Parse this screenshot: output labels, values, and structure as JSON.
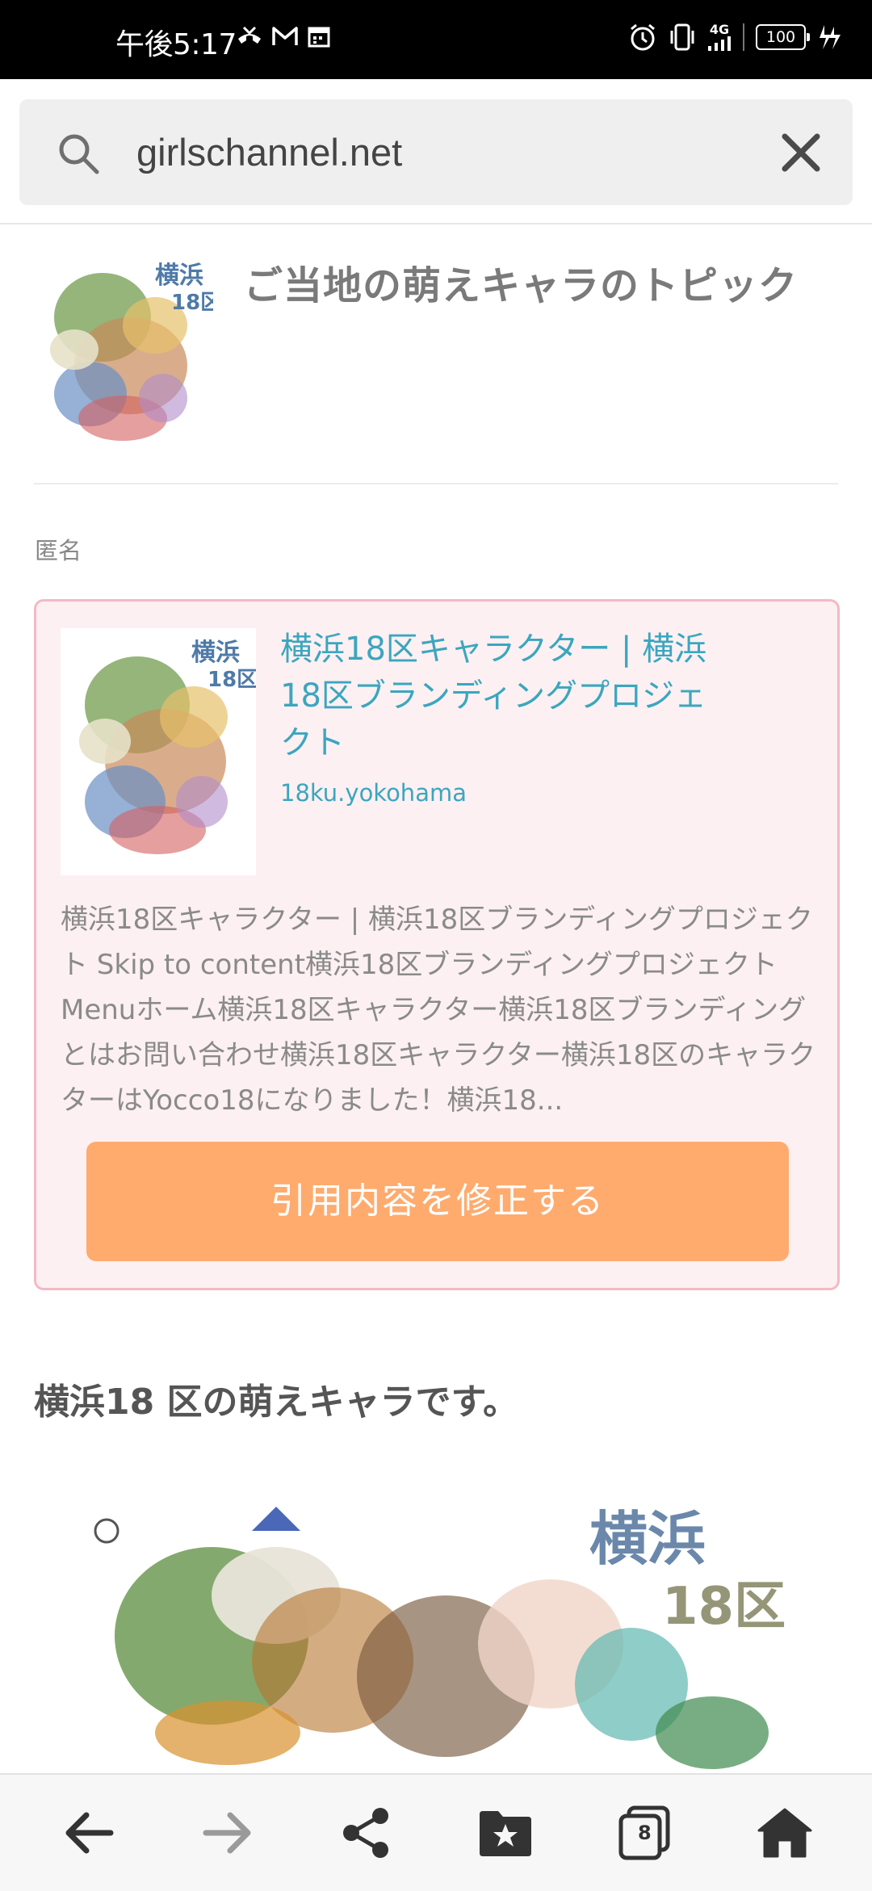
{
  "status_bar": {
    "time": "午後5:17",
    "battery": "100",
    "network": "4G",
    "icons": [
      "missed-call-icon",
      "gmail-icon",
      "calendar-icon",
      "alarm-icon",
      "vibrate-icon",
      "signal-icon",
      "battery-icon",
      "charging-icon"
    ]
  },
  "address_bar": {
    "url": "girlschannel.net",
    "icons": [
      "search-icon",
      "close-icon"
    ]
  },
  "topic": {
    "title": "ご当地の萌えキャラのトピック",
    "thumb_icon": "topic-thumbnail"
  },
  "comment": {
    "author": "匿名",
    "quote": {
      "title": "横浜18区キャラクター | 横浜18区ブランディングプロジェクト",
      "domain": "18ku.yokohama",
      "excerpt": "横浜18区キャラクター | 横浜18区ブランディングプロジェクト Skip to content横浜18区ブランディングプロジェクトMenuホーム横浜18区キャラクター横浜18区ブランディングとはお問い合わせ横浜18区キャラクター横浜18区のキャラクターはYocco18になりました！横浜18...",
      "edit_button": "引用内容を修正する",
      "accent_color": "#3ba6bf",
      "button_color": "#ffab6e"
    },
    "text": "横浜18 区の萌えキャラです。",
    "image_logo_text": "横浜18区"
  },
  "bottom_nav": {
    "tab_count": "8",
    "icons": [
      "back-arrow-icon",
      "forward-arrow-icon",
      "share-icon",
      "bookmark-folder-icon",
      "tabs-icon",
      "home-icon"
    ]
  }
}
